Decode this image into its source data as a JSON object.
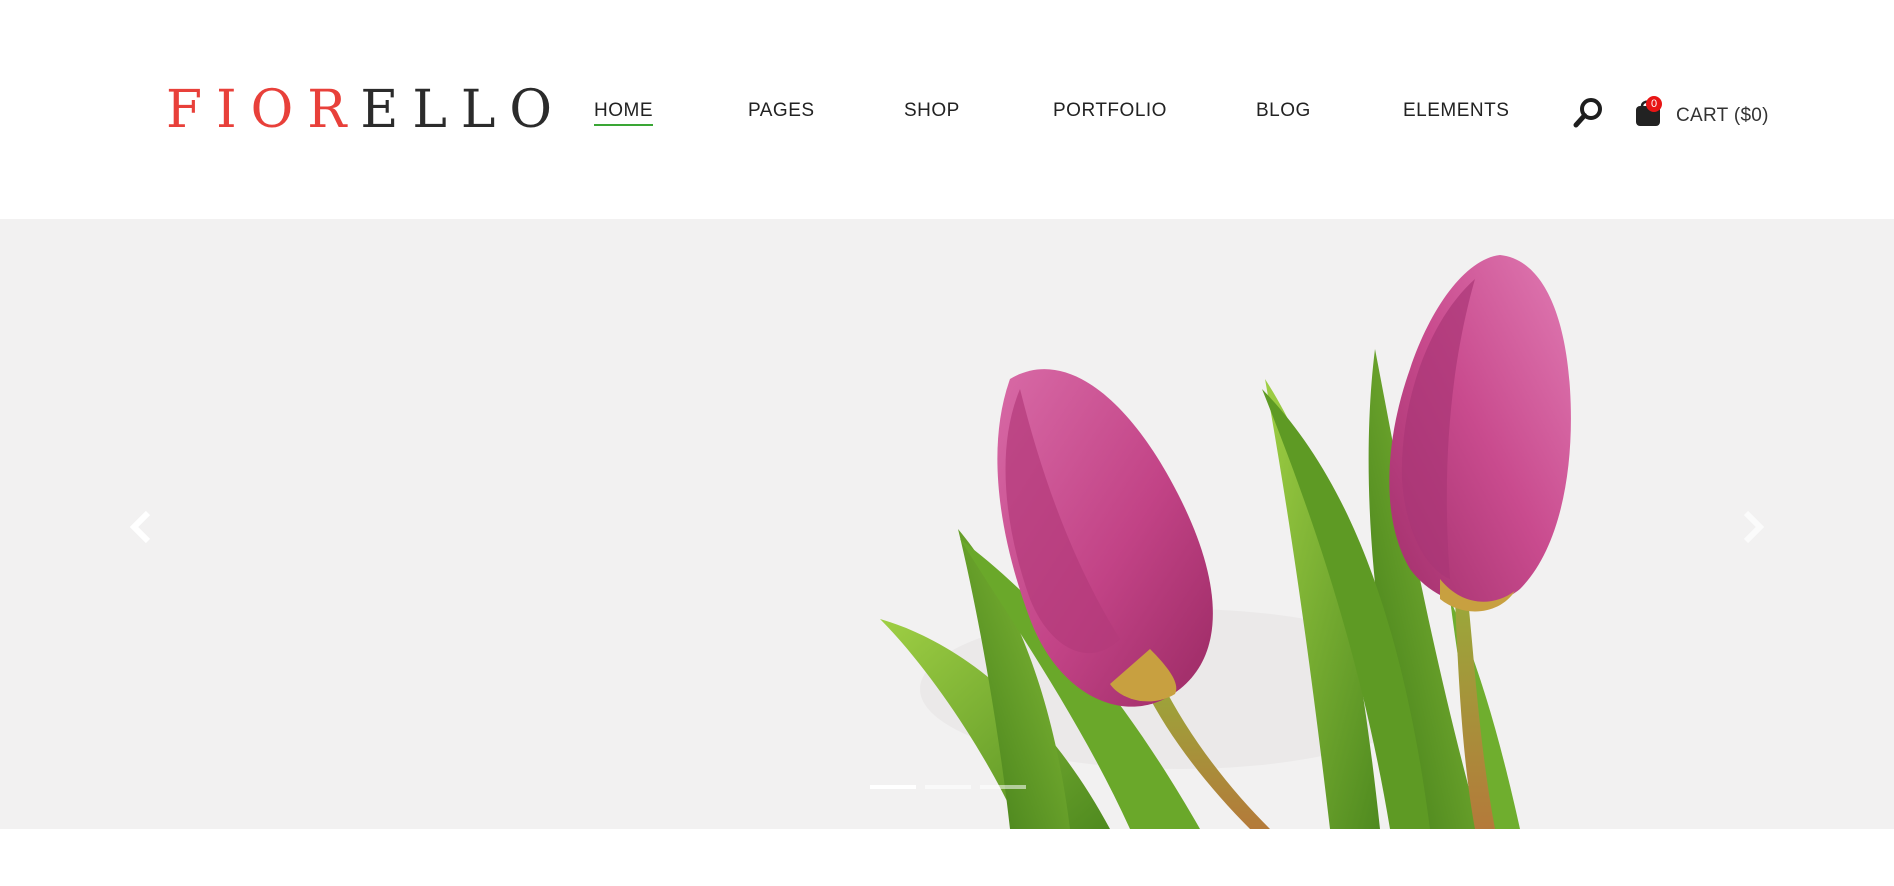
{
  "brand": {
    "logo_part1": "FIOR",
    "logo_part2": "ELLO",
    "logo_color_accent": "#e8403a",
    "logo_color_dark": "#2b2b2b"
  },
  "nav": {
    "items": [
      {
        "label": "HOME",
        "active": true
      },
      {
        "label": "PAGES",
        "active": false
      },
      {
        "label": "SHOP",
        "active": false
      },
      {
        "label": "PORTFOLIO",
        "active": false
      },
      {
        "label": "BLOG",
        "active": false
      },
      {
        "label": "ELEMENTS",
        "active": false
      }
    ],
    "active_underline_color": "#3aa635"
  },
  "header_actions": {
    "search_icon": "search-icon",
    "cart_icon": "shopping-bag-icon",
    "cart_count": "0",
    "cart_label": "CART ($0)",
    "badge_color": "#e81515"
  },
  "hero": {
    "background_color": "#f2f1f1",
    "image": "pink-tulips",
    "prev_icon": "chevron-left-icon",
    "next_icon": "chevron-right-icon",
    "slides": [
      {
        "active": true
      },
      {
        "active": false
      },
      {
        "active": false
      }
    ]
  }
}
